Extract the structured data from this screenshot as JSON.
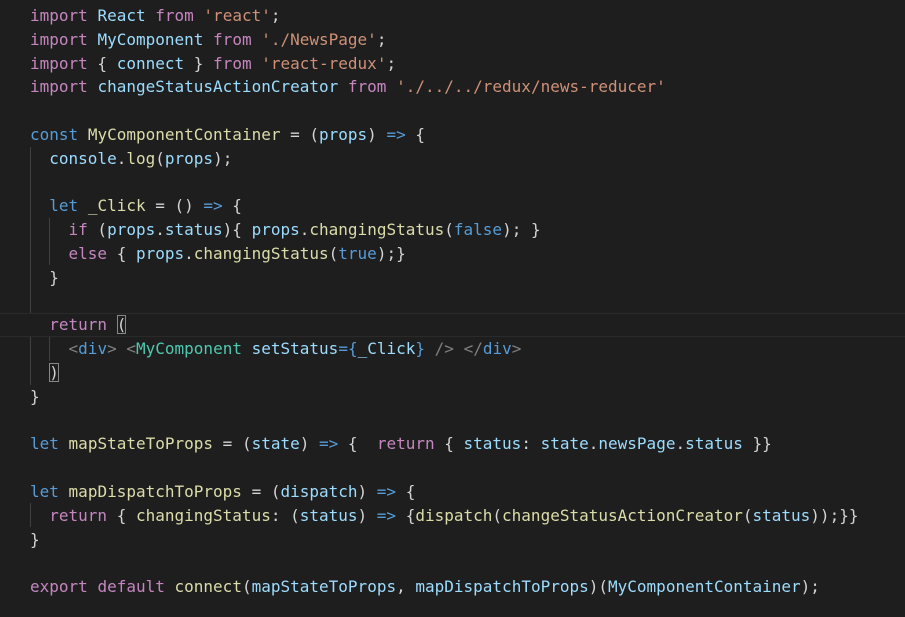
{
  "editor": {
    "language": "javascript",
    "theme_background": "#1e1e1e",
    "lines": [
      [
        {
          "t": "import",
          "c": "ctl"
        },
        {
          "t": " "
        },
        {
          "t": "React",
          "c": "var"
        },
        {
          "t": " "
        },
        {
          "t": "from",
          "c": "ctl"
        },
        {
          "t": " "
        },
        {
          "t": "'react'",
          "c": "str"
        },
        {
          "t": ";"
        }
      ],
      [
        {
          "t": "import",
          "c": "ctl"
        },
        {
          "t": " "
        },
        {
          "t": "MyComponent",
          "c": "var"
        },
        {
          "t": " "
        },
        {
          "t": "from",
          "c": "ctl"
        },
        {
          "t": " "
        },
        {
          "t": "'./NewsPage'",
          "c": "str"
        },
        {
          "t": ";"
        }
      ],
      [
        {
          "t": "import",
          "c": "ctl"
        },
        {
          "t": " { "
        },
        {
          "t": "connect",
          "c": "var"
        },
        {
          "t": " } "
        },
        {
          "t": "from",
          "c": "ctl"
        },
        {
          "t": " "
        },
        {
          "t": "'react-redux'",
          "c": "str"
        },
        {
          "t": ";"
        }
      ],
      [
        {
          "t": "import",
          "c": "ctl"
        },
        {
          "t": " "
        },
        {
          "t": "changeStatusActionCreator",
          "c": "var"
        },
        {
          "t": " "
        },
        {
          "t": "from",
          "c": "ctl"
        },
        {
          "t": " "
        },
        {
          "t": "'./../../redux/news-reducer'",
          "c": "str"
        }
      ],
      [],
      [
        {
          "t": "const",
          "c": "kw"
        },
        {
          "t": " "
        },
        {
          "t": "MyComponentContainer",
          "c": "fn"
        },
        {
          "t": " = ("
        },
        {
          "t": "props",
          "c": "var"
        },
        {
          "t": ") "
        },
        {
          "t": "=>",
          "c": "kw"
        },
        {
          "t": " {"
        }
      ],
      [
        {
          "t": "  "
        },
        {
          "t": "console",
          "c": "var"
        },
        {
          "t": "."
        },
        {
          "t": "log",
          "c": "fn"
        },
        {
          "t": "("
        },
        {
          "t": "props",
          "c": "var"
        },
        {
          "t": ");"
        }
      ],
      [],
      [
        {
          "t": "  "
        },
        {
          "t": "let",
          "c": "kw"
        },
        {
          "t": " "
        },
        {
          "t": "_Click",
          "c": "fn"
        },
        {
          "t": " = () "
        },
        {
          "t": "=>",
          "c": "kw"
        },
        {
          "t": " {"
        }
      ],
      [
        {
          "t": "    "
        },
        {
          "t": "if",
          "c": "ctl"
        },
        {
          "t": " ("
        },
        {
          "t": "props",
          "c": "var"
        },
        {
          "t": "."
        },
        {
          "t": "status",
          "c": "var"
        },
        {
          "t": "){ "
        },
        {
          "t": "props",
          "c": "var"
        },
        {
          "t": "."
        },
        {
          "t": "changingStatus",
          "c": "fn"
        },
        {
          "t": "("
        },
        {
          "t": "false",
          "c": "kw"
        },
        {
          "t": "); }"
        }
      ],
      [
        {
          "t": "    "
        },
        {
          "t": "else",
          "c": "ctl"
        },
        {
          "t": " { "
        },
        {
          "t": "props",
          "c": "var"
        },
        {
          "t": "."
        },
        {
          "t": "changingStatus",
          "c": "fn"
        },
        {
          "t": "("
        },
        {
          "t": "true",
          "c": "kw"
        },
        {
          "t": ");}"
        }
      ],
      [
        {
          "t": "  }"
        }
      ],
      [],
      [
        {
          "t": "  "
        },
        {
          "t": "return",
          "c": "ctl"
        },
        {
          "t": " "
        },
        {
          "t": "(",
          "c": "bracket-hl"
        }
      ],
      [
        {
          "t": "    "
        },
        {
          "t": "<",
          "c": "tag"
        },
        {
          "t": "div",
          "c": "tagname"
        },
        {
          "t": ">",
          "c": "tag"
        },
        {
          "t": " "
        },
        {
          "t": "<",
          "c": "tag"
        },
        {
          "t": "MyComponent",
          "c": "cls"
        },
        {
          "t": " "
        },
        {
          "t": "setStatus",
          "c": "attr"
        },
        {
          "t": "={",
          "c": "kw"
        },
        {
          "t": "_Click",
          "c": "var"
        },
        {
          "t": "}",
          "c": "kw"
        },
        {
          "t": " "
        },
        {
          "t": "/>",
          "c": "tag"
        },
        {
          "t": " "
        },
        {
          "t": "</",
          "c": "tag"
        },
        {
          "t": "div",
          "c": "tagname"
        },
        {
          "t": ">",
          "c": "tag"
        }
      ],
      [
        {
          "t": "  "
        },
        {
          "t": ")",
          "c": "bracket-hl"
        }
      ],
      [
        {
          "t": "}"
        }
      ],
      [],
      [
        {
          "t": "let",
          "c": "kw"
        },
        {
          "t": " "
        },
        {
          "t": "mapStateToProps",
          "c": "fn"
        },
        {
          "t": " = ("
        },
        {
          "t": "state",
          "c": "var"
        },
        {
          "t": ") "
        },
        {
          "t": "=>",
          "c": "kw"
        },
        {
          "t": " {  "
        },
        {
          "t": "return",
          "c": "ctl"
        },
        {
          "t": " { "
        },
        {
          "t": "status",
          "c": "var"
        },
        {
          "t": ": "
        },
        {
          "t": "state",
          "c": "var"
        },
        {
          "t": "."
        },
        {
          "t": "newsPage",
          "c": "var"
        },
        {
          "t": "."
        },
        {
          "t": "status",
          "c": "var"
        },
        {
          "t": " }}"
        }
      ],
      [],
      [
        {
          "t": "let",
          "c": "kw"
        },
        {
          "t": " "
        },
        {
          "t": "mapDispatchToProps",
          "c": "fn"
        },
        {
          "t": " = ("
        },
        {
          "t": "dispatch",
          "c": "var"
        },
        {
          "t": ") "
        },
        {
          "t": "=>",
          "c": "kw"
        },
        {
          "t": " {"
        }
      ],
      [
        {
          "t": "  "
        },
        {
          "t": "return",
          "c": "ctl"
        },
        {
          "t": " { "
        },
        {
          "t": "changingStatus",
          "c": "fn"
        },
        {
          "t": ": ("
        },
        {
          "t": "status",
          "c": "var"
        },
        {
          "t": ") "
        },
        {
          "t": "=>",
          "c": "kw"
        },
        {
          "t": " {"
        },
        {
          "t": "dispatch",
          "c": "fn"
        },
        {
          "t": "("
        },
        {
          "t": "changeStatusActionCreator",
          "c": "fn"
        },
        {
          "t": "("
        },
        {
          "t": "status",
          "c": "var"
        },
        {
          "t": "));}}"
        }
      ],
      [
        {
          "t": "}"
        }
      ],
      [],
      [
        {
          "t": "export",
          "c": "ctl"
        },
        {
          "t": " "
        },
        {
          "t": "default",
          "c": "ctl"
        },
        {
          "t": " "
        },
        {
          "t": "connect",
          "c": "fn"
        },
        {
          "t": "("
        },
        {
          "t": "mapStateToProps",
          "c": "var"
        },
        {
          "t": ", "
        },
        {
          "t": "mapDispatchToProps",
          "c": "var"
        },
        {
          "t": ")("
        },
        {
          "t": "MyComponentContainer",
          "c": "var"
        },
        {
          "t": ");"
        }
      ]
    ],
    "current_line_index": 13
  }
}
